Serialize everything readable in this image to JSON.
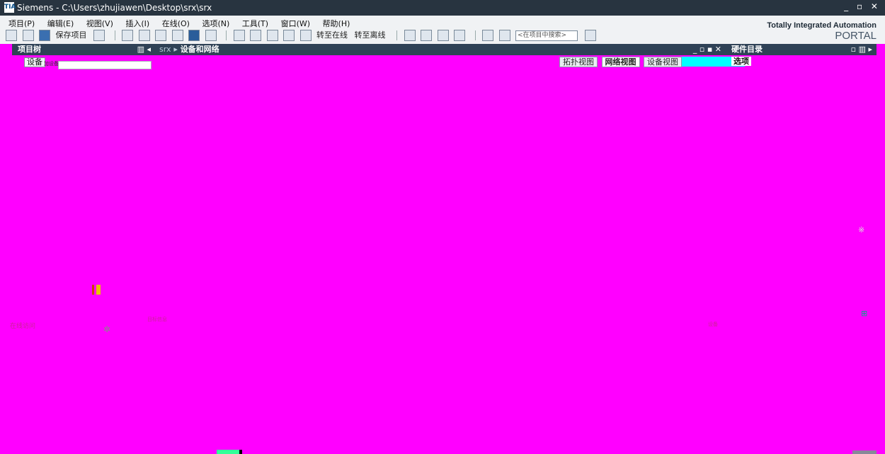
{
  "window": {
    "logo": "TIA",
    "title": "Siemens - C:\\Users\\zhujiawen\\Desktop\\srx\\srx",
    "controls": "_ ▫ ✕"
  },
  "menu": [
    "项目(P)",
    "编辑(E)",
    "视图(V)",
    "插入(I)",
    "在线(O)",
    "选项(N)",
    "工具(T)",
    "窗口(W)",
    "帮助(H)"
  ],
  "toolbar": {
    "save_label": "保存项目",
    "go_online": "转至在线",
    "go_offline": "转至离线",
    "search_placeholder": "<在项目中搜索>"
  },
  "brand": {
    "line1": "Totally Integrated Automation",
    "line2": "PORTAL"
  },
  "project_tree": {
    "title": "项目树",
    "devices_tab": "设备",
    "sub": "加设备"
  },
  "editor": {
    "project": "srx",
    "separator": "▸",
    "title": "设备和网络",
    "tabs": [
      {
        "label": "拓扑视图",
        "active": false
      },
      {
        "label": "网络视图",
        "active": true
      },
      {
        "label": "设备视图",
        "active": false
      }
    ]
  },
  "hardware_catalog": {
    "title": "硬件目录",
    "options_label": "选项"
  },
  "bottom": {
    "online_access": "在线访问",
    "status_label": "目标信息",
    "devices_label": "设备"
  },
  "colors": {
    "titlebar": "#283440",
    "panel_header": "#2f4256",
    "mask": "#ff00ff"
  }
}
